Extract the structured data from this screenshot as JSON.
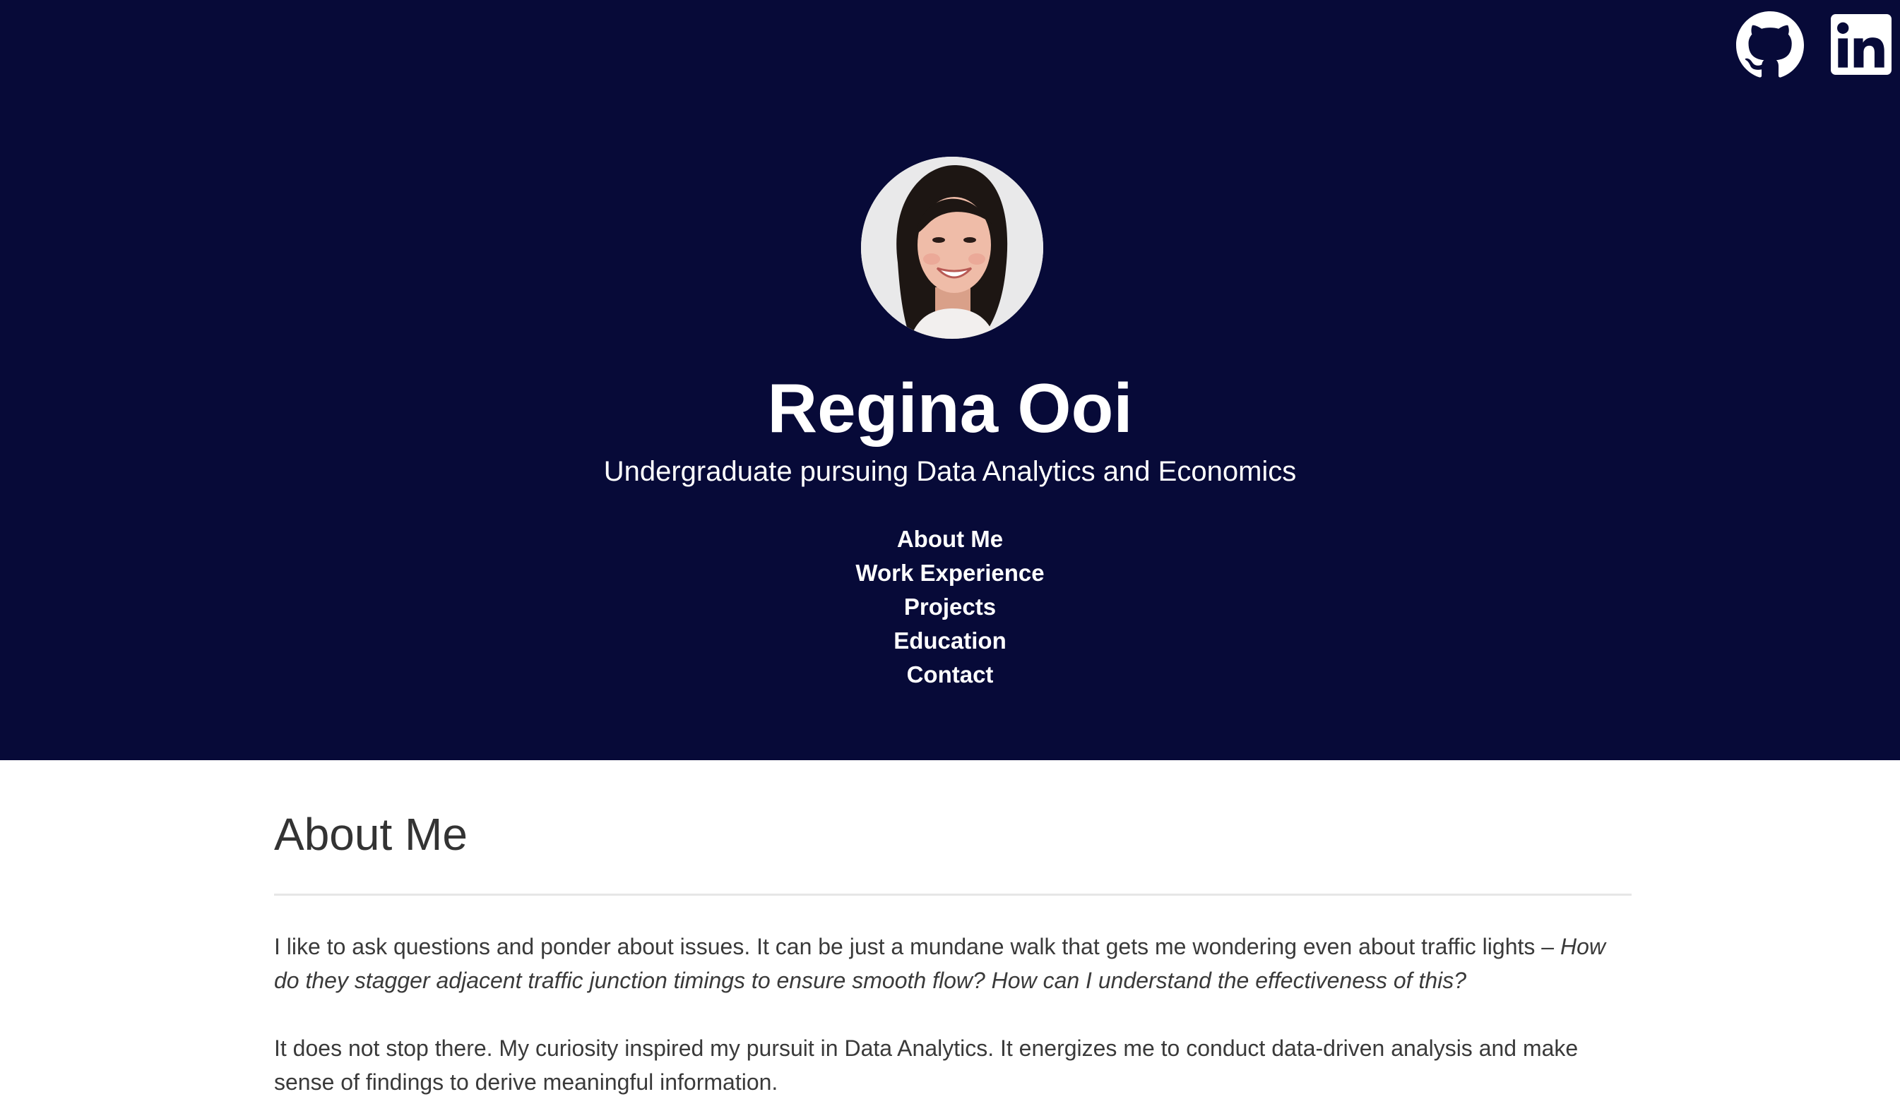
{
  "header": {
    "name": "Regina Ooi",
    "tagline": "Undergraduate pursuing Data Analytics and Economics",
    "background_color": "#070a38",
    "social": [
      {
        "icon": "github-icon"
      },
      {
        "icon": "linkedin-icon"
      }
    ],
    "nav": [
      {
        "label": "About Me"
      },
      {
        "label": "Work Experience"
      },
      {
        "label": "Projects"
      },
      {
        "label": "Education"
      },
      {
        "label": "Contact"
      }
    ]
  },
  "about": {
    "heading": "About Me",
    "paragraph1_plain": "I like to ask questions and ponder about issues. It can be just a mundane walk that gets me wondering even about traffic lights – ",
    "paragraph1_italic": "How do they stagger adjacent traffic junction timings to ensure smooth flow? How can I understand the effectiveness of this?",
    "paragraph2": "It does not stop there. My curiosity inspired my pursuit in Data Analytics. It energizes me to conduct data-driven analysis and make sense of findings to derive meaningful information."
  }
}
